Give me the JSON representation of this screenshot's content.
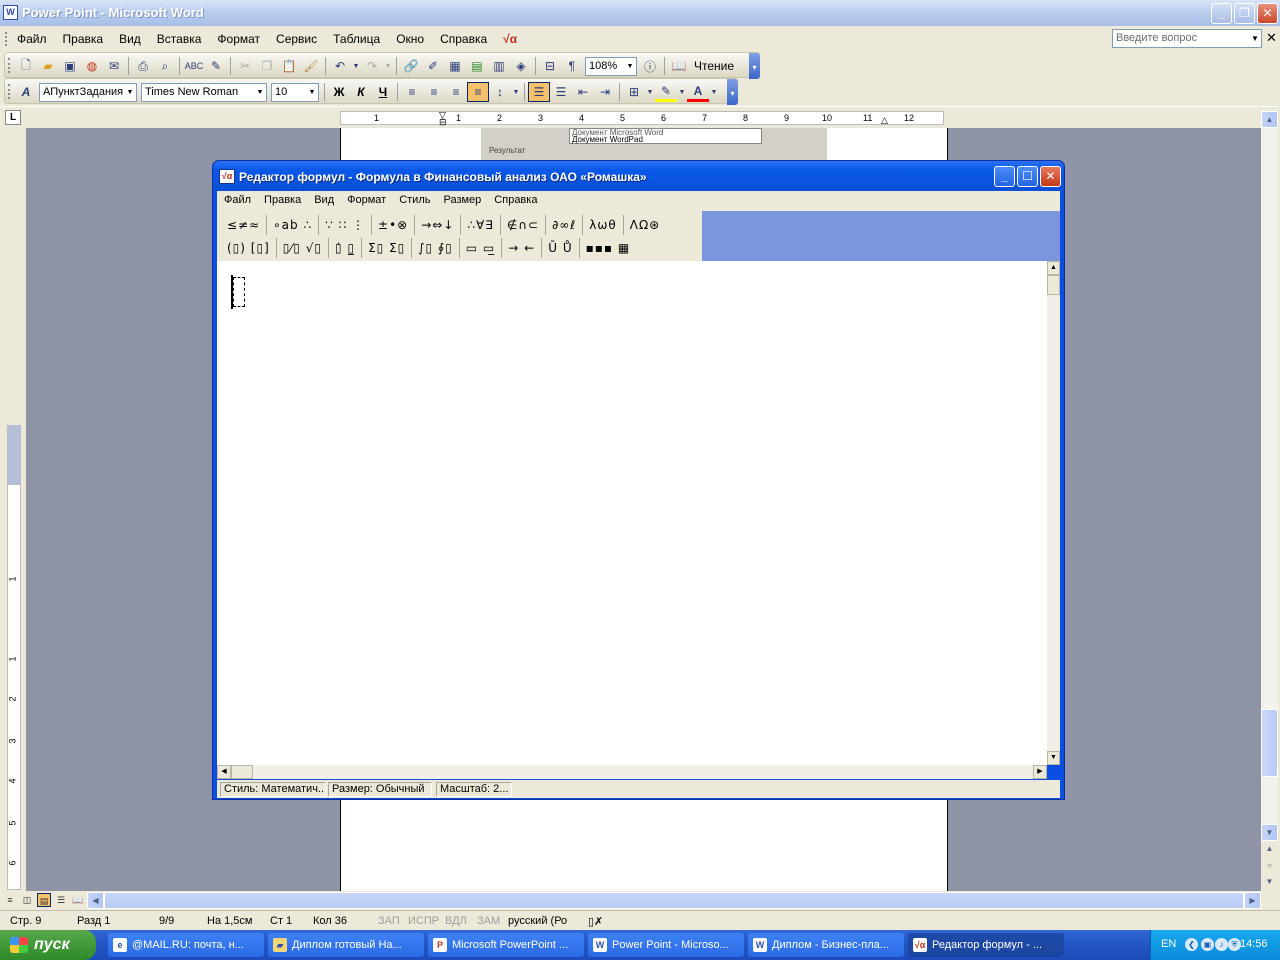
{
  "word": {
    "title": "Power Point - Microsoft Word",
    "menu": [
      "Файл",
      "Правка",
      "Вид",
      "Вставка",
      "Формат",
      "Сервис",
      "Таблица",
      "Окно",
      "Справка"
    ],
    "help_placeholder": "Введите вопрос",
    "zoom": "108%",
    "reading_label": "Чтение",
    "style": "АПунктЗадания",
    "font": "Times New Roman",
    "font_size": "10",
    "bold": "Ж",
    "italic": "К",
    "underline": "Ч"
  },
  "ruler": {
    "h_ticks": [
      "1",
      "1",
      "2",
      "3",
      "4",
      "5",
      "6",
      "7",
      "8",
      "9",
      "10",
      "11",
      "12"
    ],
    "v_ticks": [
      "1",
      "1",
      "2",
      "3",
      "4",
      "5",
      "6"
    ]
  },
  "embedded": {
    "combo_lines": [
      "Документ Microsoft Word",
      "Документ WordPad"
    ],
    "label": "Результат"
  },
  "status": {
    "page": "Стр. 9",
    "section": "Разд 1",
    "pages": "9/9",
    "at": "На 1,5см",
    "line": "Ст 1",
    "col": "Кол 36",
    "rec": "ЗАП",
    "trk": "ИСПР",
    "ext": "ВДЛ",
    "ovr": "ЗАМ",
    "lang": "русский (Ро"
  },
  "taskbar": {
    "start": "пуск",
    "items": [
      {
        "label": "@MAIL.RU: почта, н..."
      },
      {
        "label": "Диплом готовый На..."
      },
      {
        "label": "Microsoft PowerPoint ..."
      },
      {
        "label": "Power Point - Microso..."
      },
      {
        "label": "Диплом - Бизнес-пла..."
      },
      {
        "label": "Редактор формул - ..."
      }
    ],
    "lang": "EN",
    "clock": "14:56"
  },
  "equation_editor": {
    "title": "Редактор формул - Формула в Финансовый анализ ОАО «Ромашка»",
    "menu": [
      "Файл",
      "Правка",
      "Вид",
      "Формат",
      "Стиль",
      "Размер",
      "Справка"
    ],
    "palette_row1": [
      "≤≠≈",
      "∘ab ∴",
      "∵ ∷ ⋮",
      "±•⊗",
      "→⇔↓",
      "∴∀∃",
      "∉∩⊂",
      "∂∞ℓ",
      "λωθ",
      "ΛΩ⊛"
    ],
    "palette_row2": [
      "(▯) [▯]",
      "▯⁄▯ √▯",
      "▯̇ ▯̲",
      "Σ▯ Σ▯",
      "∫▯ ∮▯",
      "▭ ▭̲",
      "→ ←",
      "Ū Ů",
      "▪▪▪ ▦"
    ],
    "status_style": "Стиль: Математич...",
    "status_size": "Размер: Обычный",
    "status_zoom": "Масштаб: 2..."
  },
  "colors": {
    "xp_blue": "#0a58e8",
    "doc_bg": "#8e93a6",
    "palette_bg": "#7b96dd"
  }
}
